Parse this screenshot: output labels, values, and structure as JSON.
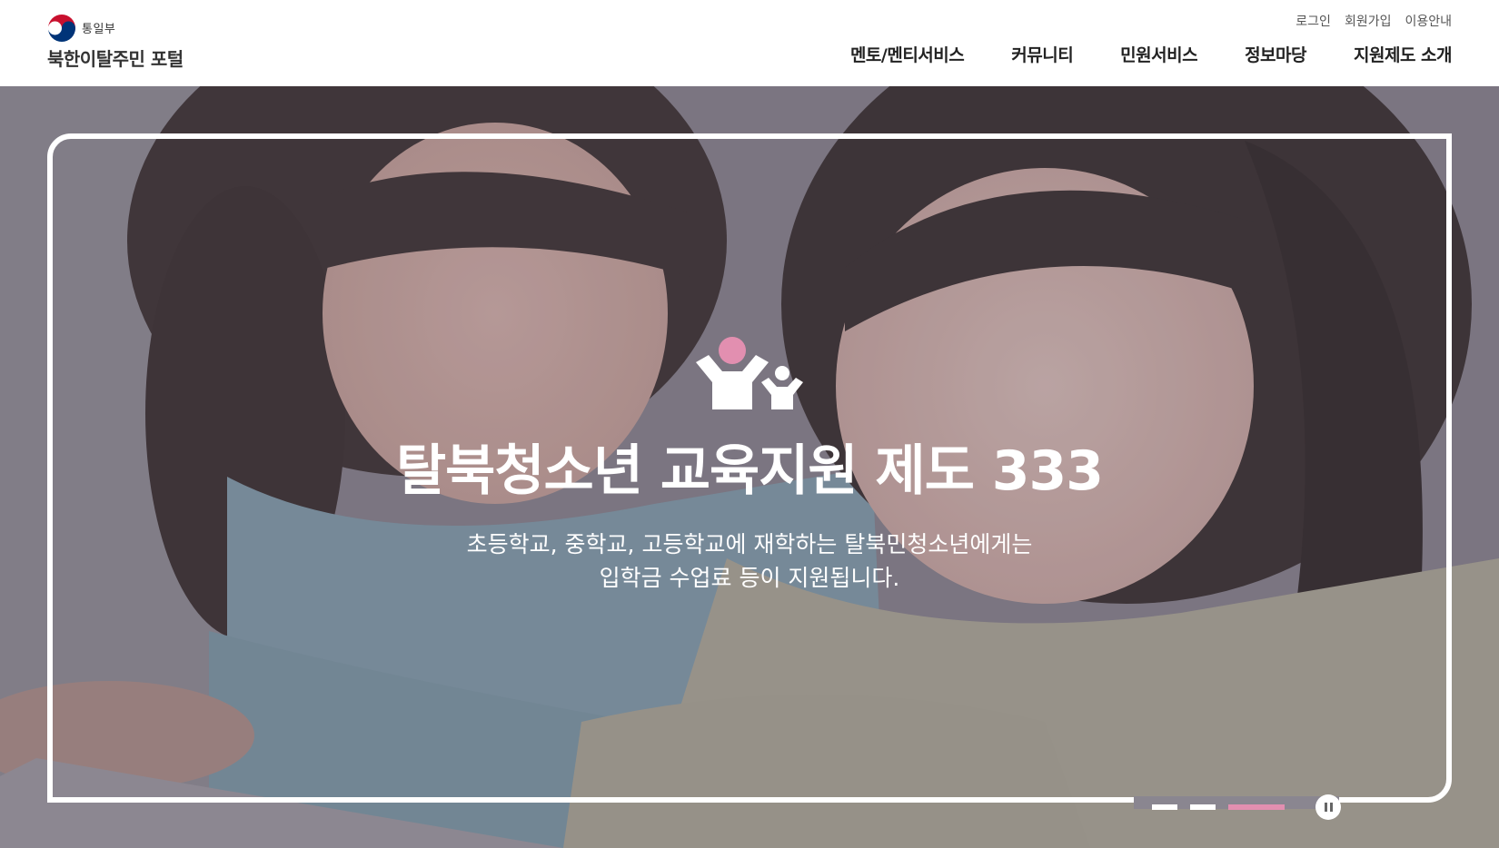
{
  "header": {
    "ministry": "통일부",
    "site_title": "북한이탈주민 포털",
    "util_links": [
      "로그인",
      "회원가입",
      "이용안내"
    ],
    "nav": [
      "멘토/멘티서비스",
      "커뮤니티",
      "민원서비스",
      "정보마당",
      "지원제도 소개"
    ]
  },
  "hero": {
    "title": "탈북청소년 교육지원 제도 333",
    "desc_line1": "초등학교, 중학교, 고등학교에 재학하는 탈북민청소년에게는",
    "desc_line2": "입학금 수업료 등이 지원됩니다.",
    "slide_count": 3,
    "active_slide": 3,
    "accent_color": "#e28fb0",
    "icon": "parent-child-icon"
  }
}
